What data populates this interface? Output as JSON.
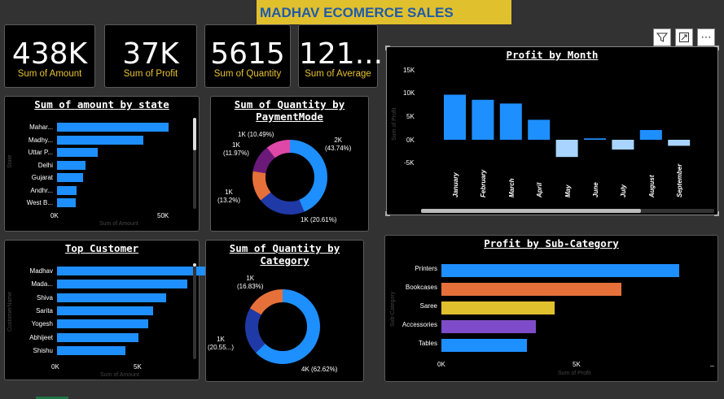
{
  "header": {
    "title": "MADHAV ECOMERCE SALES"
  },
  "kpis": [
    {
      "value": "438K",
      "label": "Sum of Amount"
    },
    {
      "value": "37K",
      "label": "Sum of Profit"
    },
    {
      "value": "5615",
      "label": "Sum of Quantity"
    },
    {
      "value": "121...",
      "label": "Sum of Average"
    }
  ],
  "toolbar": {
    "filter_icon": "filter-icon",
    "focus_icon": "focus-mode-icon",
    "more_icon": "more-options-icon",
    "more_label": "⋯"
  },
  "amount_by_state": {
    "title": "Sum of amount by state",
    "xlabel": "Sum of Amount",
    "ylabel": "State",
    "ticks": [
      "0K",
      "50K"
    ],
    "chart_data": {
      "type": "bar",
      "categories": [
        "Mahar...",
        "Madhy...",
        "Uttar P...",
        "Delhi",
        "Gujarat",
        "Andhr...",
        "West B..."
      ],
      "values": [
        102,
        79,
        37,
        26,
        24,
        18,
        17
      ],
      "color": "#1e8fff"
    }
  },
  "qty_by_payment": {
    "title_line1": "Sum of Quantity by",
    "title_line2": "PaymentMode",
    "chart_data": {
      "type": "pie",
      "categories": [
        "2K (43.74%)",
        "1K (20.61%)",
        "1K (13.2%)",
        "1K (11.97%)",
        "1K (10.49%)"
      ],
      "values": [
        43.74,
        20.61,
        13.2,
        11.97,
        10.49
      ],
      "colors": [
        "#1e8fff",
        "#1f3aa6",
        "#e6703a",
        "#6b1a7a",
        "#e048a8"
      ]
    },
    "labels": {
      "a_line1": "2K",
      "a_line2": "(43.74%)",
      "b": "1K (20.61%)",
      "c_line1": "1K",
      "c_line2": "(13.2%)",
      "d_line1": "1K",
      "d_line2": "(11.97%)",
      "e": "1K (10.49%)"
    }
  },
  "profit_by_month": {
    "title": "Profit by Month",
    "ylabel": "Sum of Profit",
    "ticks": [
      "15K",
      "10K",
      "5K",
      "0K",
      "-5K"
    ],
    "chart_data": {
      "type": "bar",
      "categories": [
        "January",
        "February",
        "March",
        "April",
        "May",
        "June",
        "July",
        "August",
        "September"
      ],
      "values": [
        9.7,
        8.6,
        7.8,
        4.3,
        -3.7,
        0.3,
        -2.1,
        2.1,
        -1.3
      ],
      "ylim": [
        -5,
        15
      ],
      "positive_color": "#1e8fff",
      "negative_color": "#a8d4ff"
    }
  },
  "top_customer": {
    "title": "Top Customer",
    "xlabel": "Sum of Amount",
    "ylabel": "CustomerName",
    "ticks": [
      "0K",
      "5K"
    ],
    "chart_data": {
      "type": "bar",
      "categories": [
        "Madhav",
        "Mada...",
        "Shiva",
        "Sarita",
        "Yogesh",
        "Abhijeet",
        "Shishu"
      ],
      "values": [
        9.3,
        8.0,
        6.7,
        5.9,
        5.6,
        5.0,
        4.2
      ],
      "color": "#1e8fff"
    }
  },
  "qty_by_category": {
    "title_line1": "Sum of Quantity by",
    "title_line2": "Category",
    "chart_data": {
      "type": "pie",
      "categories": [
        "4K (62.62%)",
        "1K (20.55...)",
        "1K (16.83%)"
      ],
      "values": [
        62.62,
        20.55,
        16.83
      ],
      "colors": [
        "#1e8fff",
        "#1f3aa6",
        "#e6703a"
      ]
    },
    "labels": {
      "a": "4K (62.62%)",
      "b_line1": "1K",
      "b_line2": "(20.55...)",
      "c_line1": "1K",
      "c_line2": "(16.83%)"
    }
  },
  "profit_by_subcat": {
    "title": "Profit by Sub-Category",
    "xlabel": "Sum of Profit",
    "ylabel": "Sub-Category",
    "ticks": [
      "0K",
      "5K"
    ],
    "chart_data": {
      "type": "bar",
      "categories": [
        "Printers",
        "Bookcases",
        "Saree",
        "Accessories",
        "Tables"
      ],
      "values": [
        8.6,
        6.5,
        4.1,
        3.4,
        3.1
      ],
      "colors": [
        "#1e8fff",
        "#e6703a",
        "#e1c02e",
        "#7e4cc8",
        "#1e8fff"
      ]
    }
  }
}
